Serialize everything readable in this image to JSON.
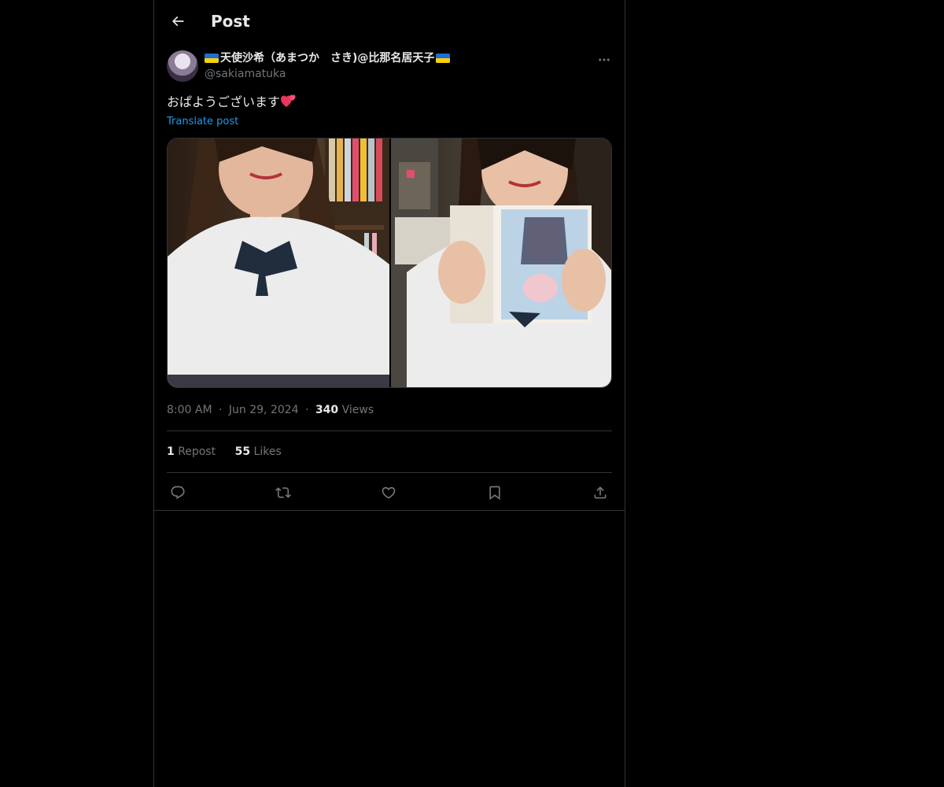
{
  "header": {
    "title": "Post"
  },
  "author": {
    "name": "天使沙希（あまつか　さき)@比那名居天子",
    "handle": "@sakiamatuka"
  },
  "post": {
    "text": "おぱようございます",
    "translate_label": "Translate post",
    "time": "8:00 AM",
    "date": "Jun 29, 2024",
    "separator": "·",
    "views_count": "340",
    "views_label": "Views"
  },
  "engagement": {
    "reposts_count": "1",
    "reposts_label": "Repost",
    "likes_count": "55",
    "likes_label": "Likes"
  },
  "icons": {
    "back": "arrow-left-icon",
    "more": "more-horizontal-icon",
    "reply": "reply-icon",
    "repost": "repost-icon",
    "like": "heart-icon",
    "bookmark": "bookmark-icon",
    "share": "share-icon"
  },
  "colors": {
    "background": "#000000",
    "text": "#e7e9ea",
    "muted": "#71767b",
    "link": "#1d9bf0",
    "border": "#2f3336"
  }
}
